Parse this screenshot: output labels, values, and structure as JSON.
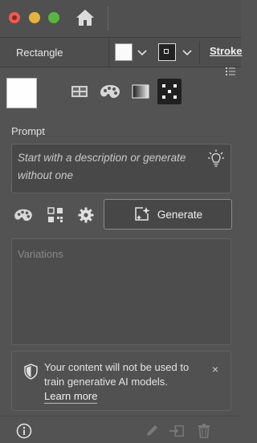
{
  "titlebar": {
    "window_controls": [
      "close",
      "minimize",
      "zoom"
    ],
    "home_icon": "home-icon"
  },
  "control_bar": {
    "object_type": "Rectangle",
    "fill_color": "#ffffff",
    "stroke_color": "#222222",
    "stroke_label": "Stroke"
  },
  "style_picker": {
    "preview_color": "#ffffff",
    "icons": [
      "layout-grid-icon",
      "palette-icon",
      "gradient-icon",
      "pattern-icon"
    ],
    "active": "pattern-icon"
  },
  "prompt": {
    "label": "Prompt",
    "placeholder": "Start with a description or generate without one",
    "hint_icon": "lightbulb-icon"
  },
  "actions": {
    "tool_icons": [
      "palette-icon",
      "qr-grid-icon",
      "gear-icon"
    ],
    "generate_label": "Generate"
  },
  "variations": {
    "label": "Variations"
  },
  "notice": {
    "text": "Your content will not be used to train generative AI models.",
    "link": "Learn more",
    "close": "×"
  },
  "footer": {
    "icons": [
      "info-icon",
      "pencil-icon",
      "export-icon",
      "trash-icon"
    ]
  },
  "colors": {
    "panel_bg": "#535353",
    "active_button": "#202020"
  }
}
